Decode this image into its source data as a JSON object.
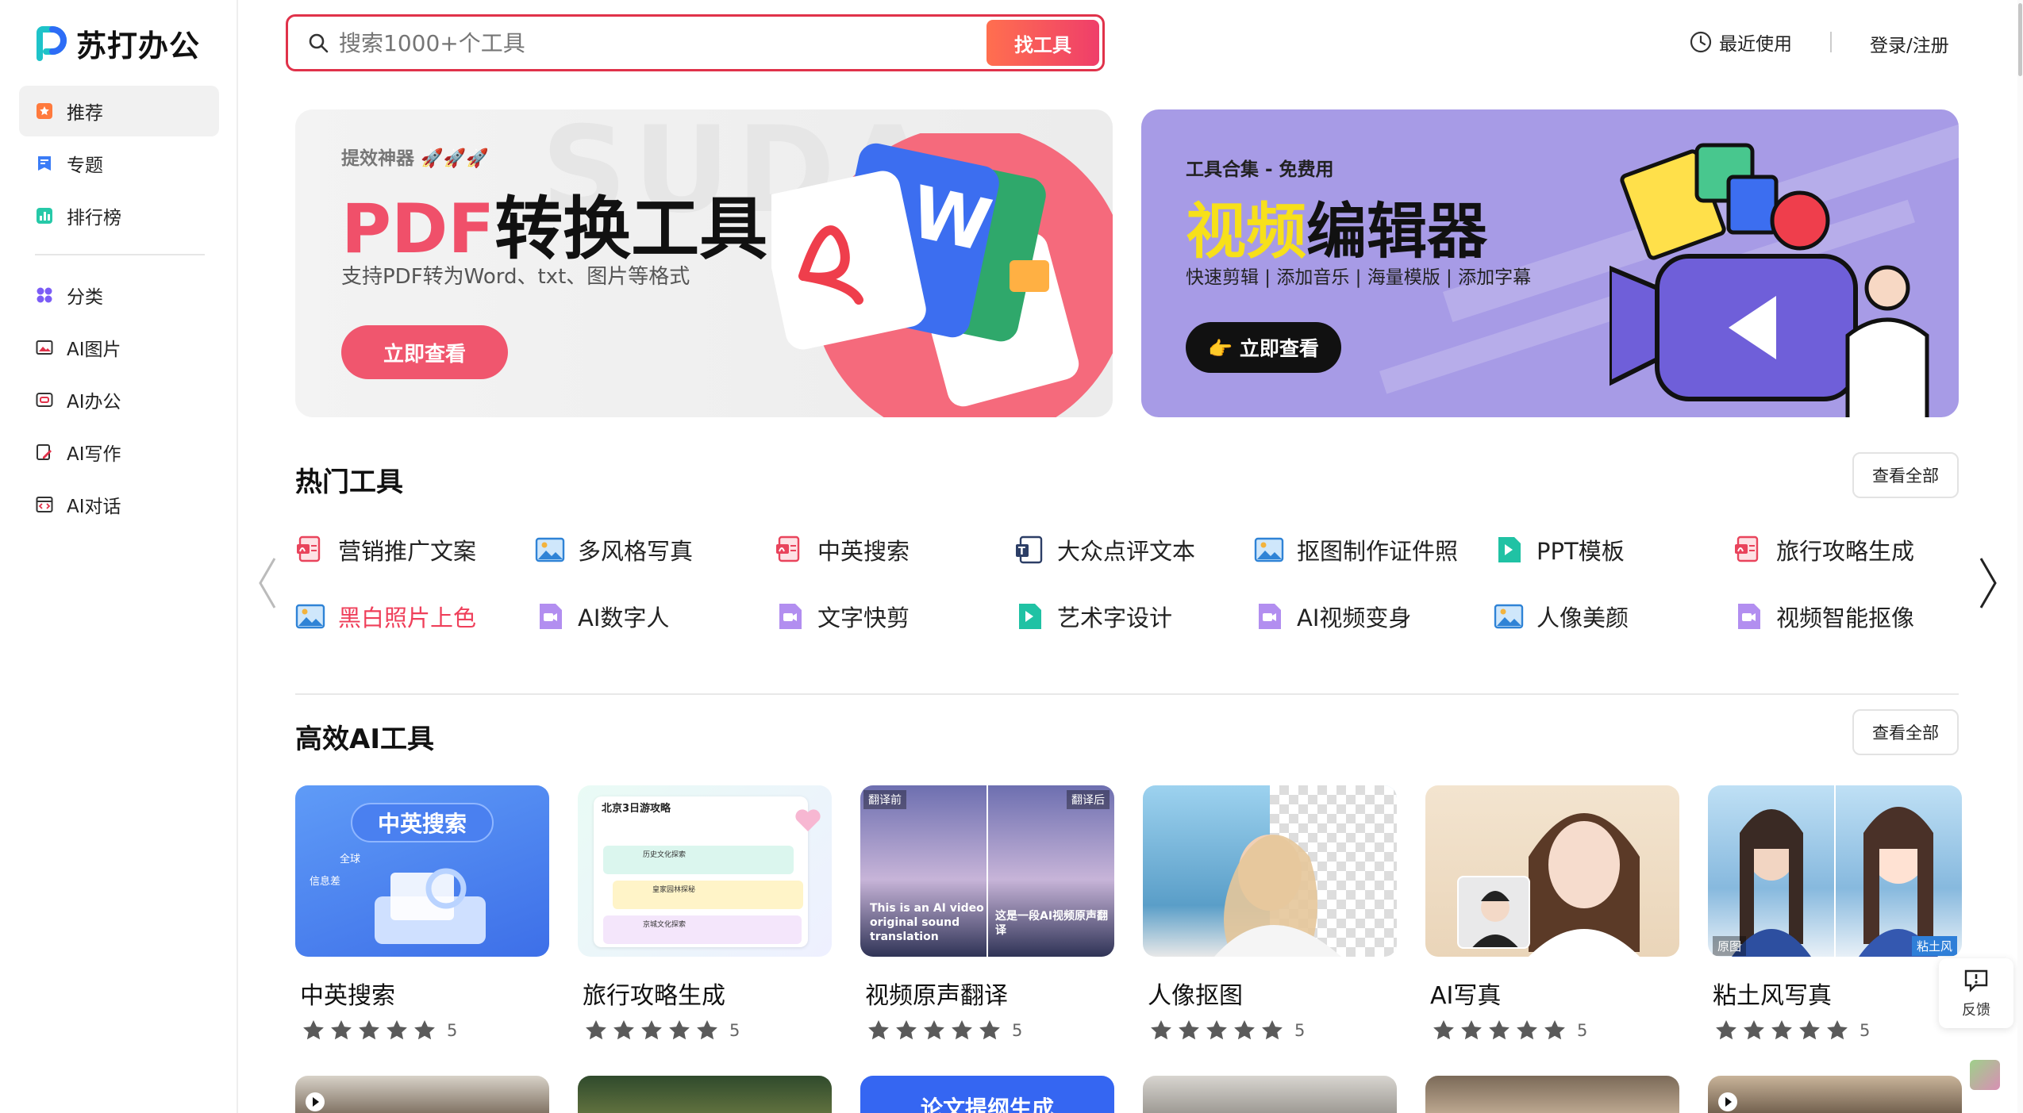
{
  "brand": {
    "name": "苏打办公"
  },
  "search": {
    "placeholder": "搜索1000+个工具",
    "button": "找工具"
  },
  "header": {
    "recent": "最近使用",
    "login": "登录/注册"
  },
  "sidebar": {
    "items": [
      {
        "label": "推荐",
        "icon": "star-box-icon"
      },
      {
        "label": "专题",
        "icon": "bookmark-icon"
      },
      {
        "label": "排行榜",
        "icon": "bar-chart-icon"
      },
      {
        "label": "分类",
        "icon": "grid-icon"
      },
      {
        "label": "AI图片",
        "icon": "image-icon"
      },
      {
        "label": "AI办公",
        "icon": "office-icon"
      },
      {
        "label": "AI写作",
        "icon": "pen-icon"
      },
      {
        "label": "AI对话",
        "icon": "code-icon"
      }
    ]
  },
  "banners": [
    {
      "tag": "提效神器 🚀🚀🚀",
      "title_accent": "PDF",
      "title_rest": "转换工具",
      "subtitle": "支持PDF转为Word、txt、图片等格式",
      "button": "立即查看"
    },
    {
      "tag": "工具合集 - 免费用",
      "title_accent": "视频",
      "title_rest": "编辑器",
      "subtitle": "快速剪辑 | 添加音乐 | 海量模版 | 添加字幕",
      "button": "👉 立即查看"
    }
  ],
  "hot_tools": {
    "title": "热门工具",
    "view_all": "查看全部",
    "items": [
      {
        "label": "营销推广文案",
        "icon": "doc-red-icon"
      },
      {
        "label": "多风格写真",
        "icon": "picture-blue-icon"
      },
      {
        "label": "中英搜索",
        "icon": "doc-red-icon"
      },
      {
        "label": "大众点评文本",
        "icon": "text-doc-icon"
      },
      {
        "label": "抠图制作证件照",
        "icon": "picture-blue-icon"
      },
      {
        "label": "PPT模板",
        "icon": "ppt-teal-icon"
      },
      {
        "label": "旅行攻略生成",
        "icon": "doc-red-icon"
      },
      {
        "label": "黑白照片上色",
        "icon": "picture-blue-icon"
      },
      {
        "label": "AI数字人",
        "icon": "video-purple-icon"
      },
      {
        "label": "文字快剪",
        "icon": "video-purple-icon"
      },
      {
        "label": "艺术字设计",
        "icon": "ppt-teal-icon"
      },
      {
        "label": "AI视频变身",
        "icon": "video-purple-icon"
      },
      {
        "label": "人像美颜",
        "icon": "picture-blue-icon"
      },
      {
        "label": "视频智能抠像",
        "icon": "video-purple-icon"
      }
    ]
  },
  "ai_tools": {
    "title": "高效AI工具",
    "view_all": "查看全部",
    "cards": [
      {
        "name": "中英搜索",
        "rating": "5",
        "stars": 5,
        "image_text": "中英搜索",
        "image_sub1": "全球",
        "image_sub2": "信息差"
      },
      {
        "name": "旅行攻略生成",
        "rating": "5",
        "stars": 5,
        "image_text": "北京3日游攻略",
        "image_sub1": "历史文化探索",
        "image_sub2": "皇家园林探秘",
        "image_sub3": "京城文化探索"
      },
      {
        "name": "视频原声翻译",
        "rating": "5",
        "stars": 5,
        "image_text": "翻译前",
        "image_sub1": "翻译后",
        "image_sub2": "This is an AI video original sound translation",
        "image_sub3": "这是一段AI视频原声翻译"
      },
      {
        "name": "人像抠图",
        "rating": "5",
        "stars": 5
      },
      {
        "name": "AI写真",
        "rating": "5",
        "stars": 5
      },
      {
        "name": "粘土风写真",
        "rating": "5",
        "stars": 5,
        "image_text": "原图",
        "image_sub1": "粘土风"
      }
    ],
    "next_row_text": "论文提纲生成"
  },
  "feedback": {
    "label": "反馈"
  },
  "colors": {
    "accent": "#ef3f5a",
    "banner2_bg": "#a79be6",
    "yellow": "#f7e01a"
  }
}
